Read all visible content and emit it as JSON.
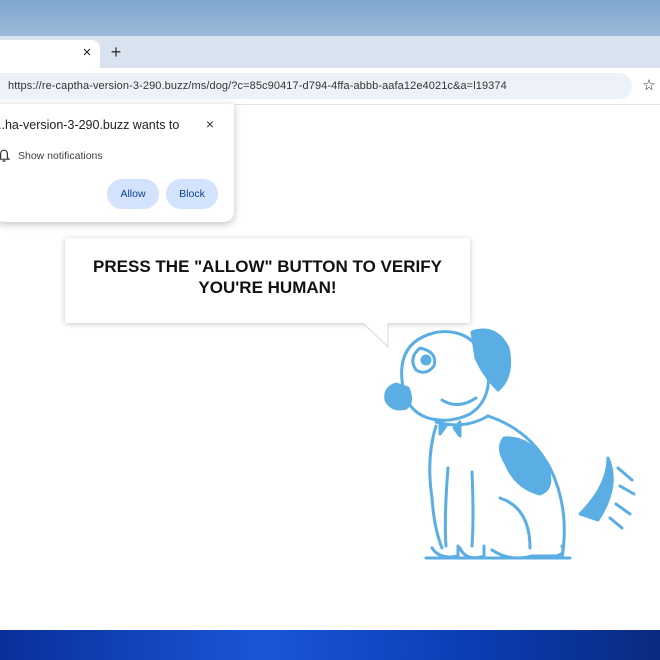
{
  "browser": {
    "tab_close_glyph": "×",
    "new_tab_glyph": "+",
    "url": "https://re-captha-version-3-290.buzz/ms/dog/?c=85c90417-d794-4ffa-abbb-aafa12e4021c&a=l19374",
    "bookmark_icon": "star-icon"
  },
  "permission_popup": {
    "title": "..ha-version-3-290.buzz wants to",
    "close_glyph": "×",
    "permission_label": "Show notifications",
    "allow_label": "Allow",
    "block_label": "Block",
    "button_color": "#d3e3fd"
  },
  "page": {
    "bubble_text": "PRESS THE \"ALLOW\" BUTTON TO VERIFY YOU'RE HUMAN!",
    "dog_color": "#5aaee3"
  },
  "colors": {
    "titlebar": "#8fb0d4",
    "tabstrip": "#d9e3ef",
    "omnibox": "#edf2f8",
    "taskbar": "#1a56d8"
  }
}
